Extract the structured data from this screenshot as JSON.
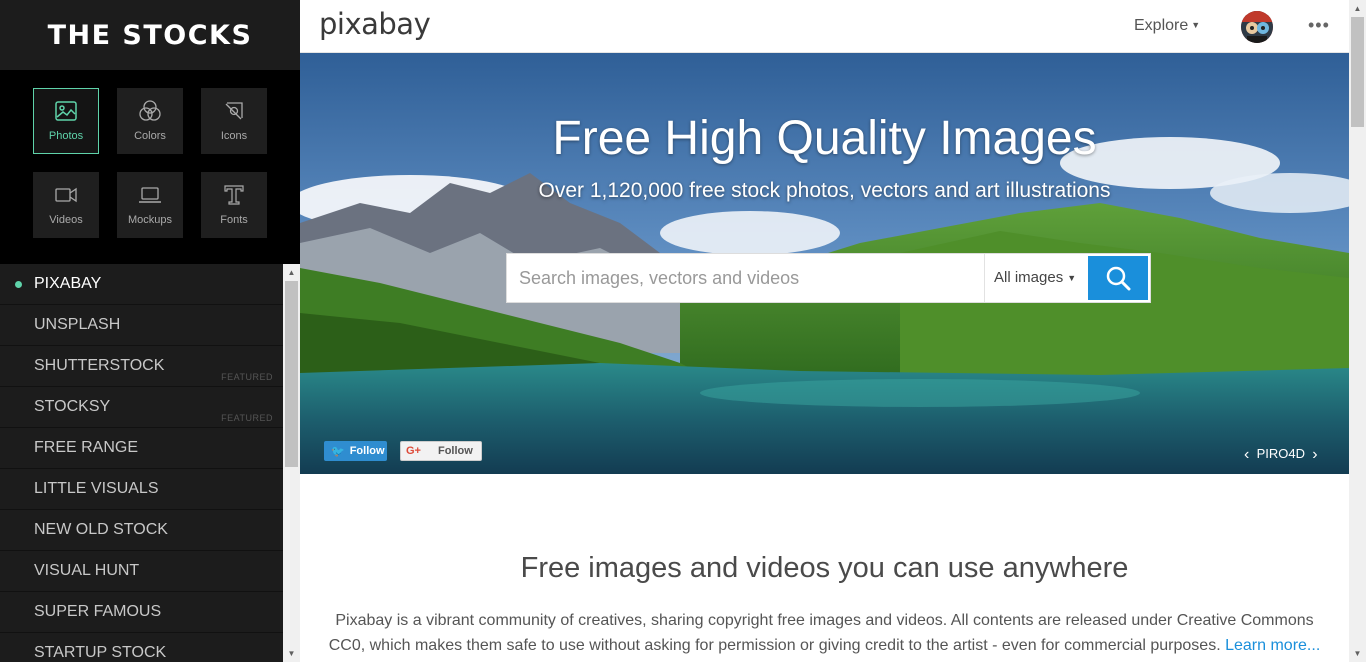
{
  "sidebar": {
    "logo": "THE STOCKS",
    "categories": [
      {
        "label": "Photos",
        "icon": "photo-icon"
      },
      {
        "label": "Colors",
        "icon": "colors-icon"
      },
      {
        "label": "Icons",
        "icon": "icons-icon"
      },
      {
        "label": "Videos",
        "icon": "video-icon"
      },
      {
        "label": "Mockups",
        "icon": "laptop-icon"
      },
      {
        "label": "Fonts",
        "icon": "font-icon"
      }
    ],
    "active_category": "Photos",
    "sites": [
      {
        "name": "PIXABAY",
        "active": true
      },
      {
        "name": "UNSPLASH"
      },
      {
        "name": "SHUTTERSTOCK",
        "badge": "FEATURED"
      },
      {
        "name": "STOCKSY",
        "badge": "FEATURED"
      },
      {
        "name": "FREE RANGE"
      },
      {
        "name": "LITTLE VISUALS"
      },
      {
        "name": "NEW OLD STOCK"
      },
      {
        "name": "VISUAL HUNT"
      },
      {
        "name": "SUPER FAMOUS"
      },
      {
        "name": "STARTUP STOCK"
      }
    ],
    "accent_color": "#5fd3aa"
  },
  "header": {
    "logo": "pixabay",
    "explore": "Explore"
  },
  "hero": {
    "title": "Free High Quality Images",
    "subtitle": "Over 1,120,000 free stock photos, vectors and art illustrations",
    "search_placeholder": "Search images, vectors and videos",
    "search_type": "All images",
    "twitter_follow": "Follow",
    "gplus_follow": "Follow",
    "gplus_mark": "G+",
    "credit": "PIRO4D"
  },
  "intro": {
    "title": "Free images and videos you can use anywhere",
    "text": "Pixabay is a vibrant community of creatives, sharing copyright free images and videos. All contents are released under Creative Commons CC0, which makes them safe to use without asking for permission or giving credit to the artist - even for commercial purposes.",
    "link": "Learn more..."
  },
  "colors": {
    "search_button": "#1a8fdb",
    "twitter": "#2f8dd0"
  }
}
